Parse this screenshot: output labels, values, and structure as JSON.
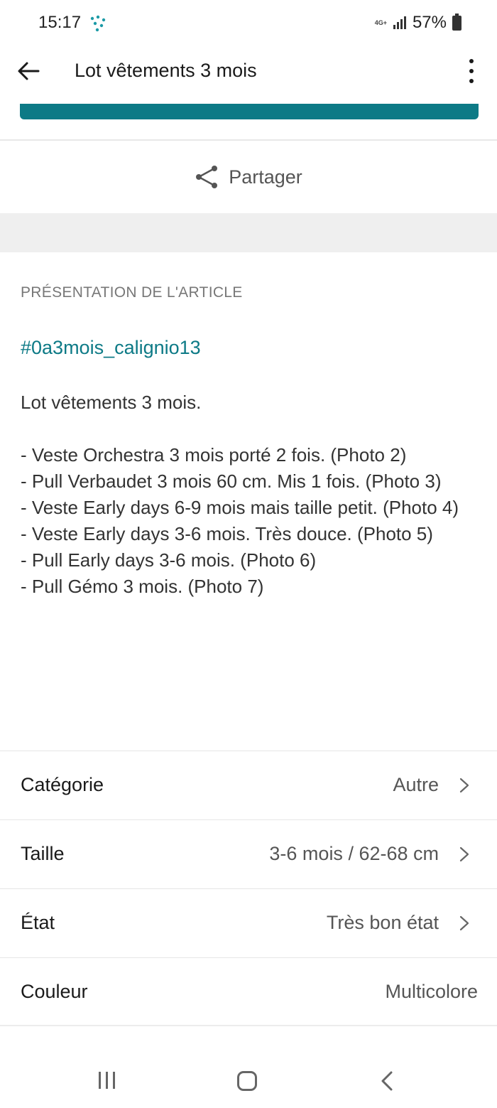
{
  "status_bar": {
    "time": "15:17",
    "network": "4G+",
    "battery": "57%"
  },
  "app_bar": {
    "title": "Lot vêtements 3 mois"
  },
  "share": {
    "label": "Partager"
  },
  "description": {
    "section_title": "PRÉSENTATION DE L'ARTICLE",
    "hashtag": "#0a3mois_calignio13",
    "intro": "Lot vêtements 3 mois.",
    "lines": [
      "- Veste Orchestra 3 mois porté 2 fois. (Photo 2)",
      "- Pull Verbaudet 3 mois 60 cm. Mis 1 fois. (Photo 3)",
      "- Veste Early days 6-9 mois mais taille petit. (Photo 4)",
      "- Veste Early days 3-6 mois. Très douce. (Photo 5)",
      "- Pull Early days 3-6 mois. (Photo 6)",
      "- Pull Gémo 3 mois. (Photo 7)"
    ]
  },
  "attributes": [
    {
      "label": "Catégorie",
      "value": "Autre"
    },
    {
      "label": "Taille",
      "value": "3-6 mois / 62-68 cm"
    },
    {
      "label": "État",
      "value": "Très bon état"
    },
    {
      "label": "Couleur",
      "value": "Multicolore"
    }
  ],
  "colors": {
    "accent": "#0d7a86",
    "band": "#efefef"
  },
  "icons": {
    "back": "arrow-left-icon",
    "more": "more-vertical-icon",
    "share": "share-icon",
    "chevron": "chevron-right-icon"
  }
}
